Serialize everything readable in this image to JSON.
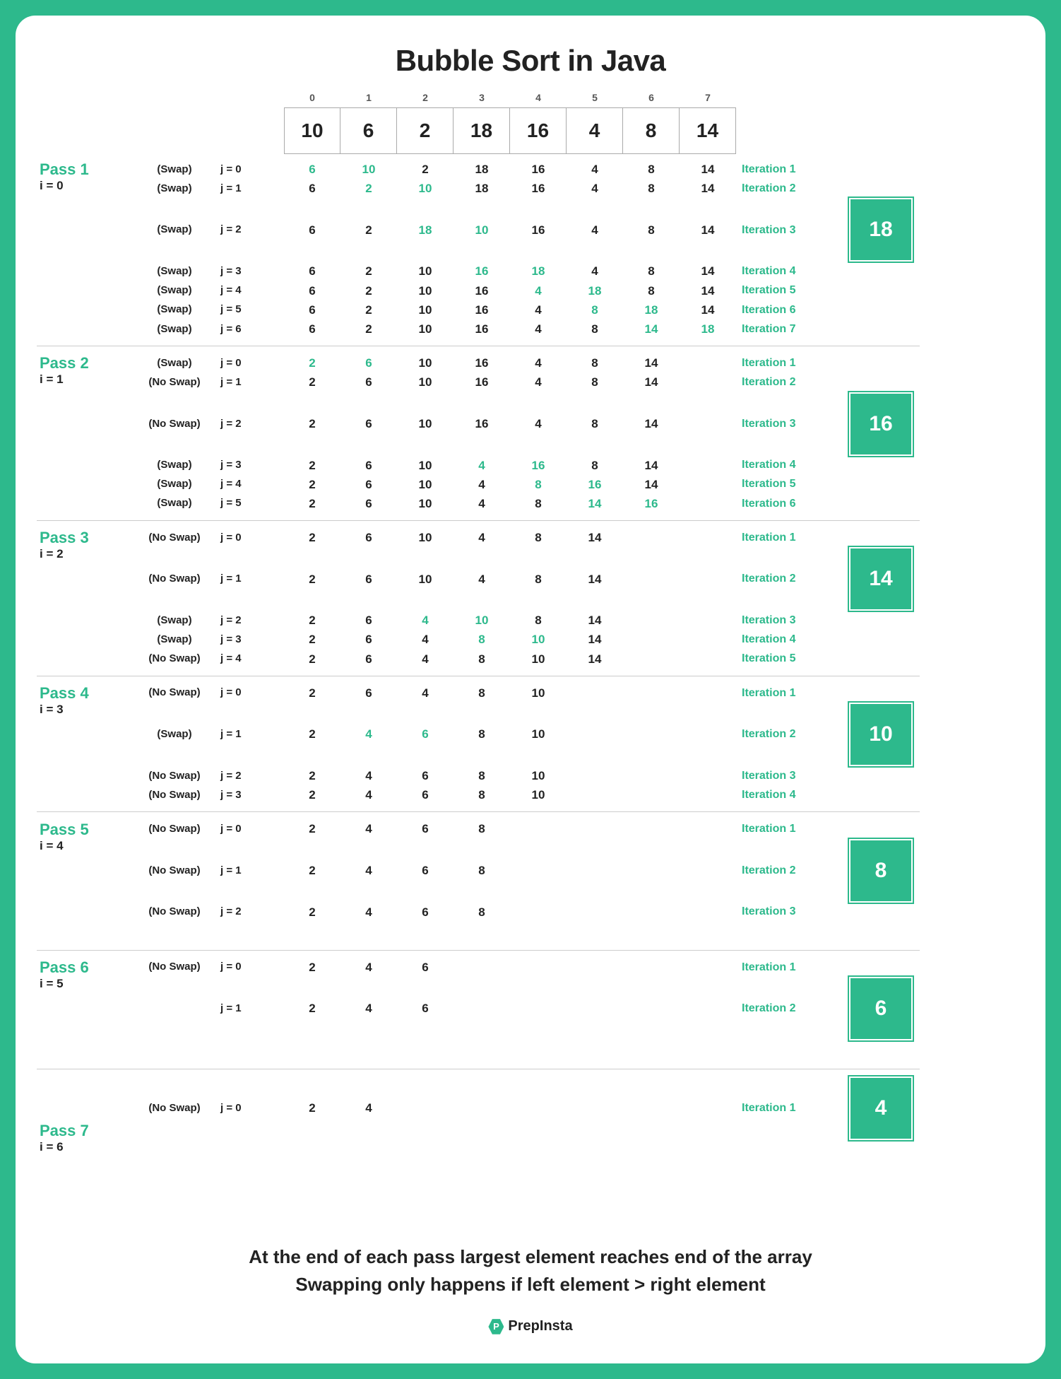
{
  "title": "Bubble Sort in Java",
  "indices": [
    "0",
    "1",
    "2",
    "3",
    "4",
    "5",
    "6",
    "7"
  ],
  "initial_array": [
    "10",
    "6",
    "2",
    "18",
    "16",
    "4",
    "8",
    "14"
  ],
  "passes": [
    {
      "name": "Pass 1",
      "i": "i = 0",
      "result": "18",
      "rows": [
        {
          "swap": "(Swap)",
          "j": "j = 0",
          "vals": [
            "6",
            "10",
            "2",
            "18",
            "16",
            "4",
            "8",
            "14"
          ],
          "hl": [
            0,
            1
          ],
          "iter": "Iteration 1"
        },
        {
          "swap": "(Swap)",
          "j": "j = 1",
          "vals": [
            "6",
            "2",
            "10",
            "18",
            "16",
            "4",
            "8",
            "14"
          ],
          "hl": [
            1,
            2
          ],
          "iter": "Iteration 2"
        },
        {
          "swap": "(Swap)",
          "j": "j = 2",
          "vals": [
            "6",
            "2",
            "18",
            "10",
            "16",
            "4",
            "8",
            "14"
          ],
          "hl": [
            2,
            3
          ],
          "iter": "Iteration 3"
        },
        {
          "swap": "(Swap)",
          "j": "j = 3",
          "vals": [
            "6",
            "2",
            "10",
            "16",
            "18",
            "4",
            "8",
            "14"
          ],
          "hl": [
            3,
            4
          ],
          "iter": "Iteration 4"
        },
        {
          "swap": "(Swap)",
          "j": "j = 4",
          "vals": [
            "6",
            "2",
            "10",
            "16",
            "4",
            "18",
            "8",
            "14"
          ],
          "hl": [
            4,
            5
          ],
          "iter": "Iteration 5"
        },
        {
          "swap": "(Swap)",
          "j": "j = 5",
          "vals": [
            "6",
            "2",
            "10",
            "16",
            "4",
            "8",
            "18",
            "14"
          ],
          "hl": [
            5,
            6
          ],
          "iter": "Iteration 6"
        },
        {
          "swap": "(Swap)",
          "j": "j = 6",
          "vals": [
            "6",
            "2",
            "10",
            "16",
            "4",
            "8",
            "14",
            "18"
          ],
          "hl": [
            6,
            7
          ],
          "iter": "Iteration 7"
        }
      ]
    },
    {
      "name": "Pass 2",
      "i": "i = 1",
      "result": "16",
      "rows": [
        {
          "swap": "(Swap)",
          "j": "j = 0",
          "vals": [
            "2",
            "6",
            "10",
            "16",
            "4",
            "8",
            "14",
            ""
          ],
          "hl": [
            0,
            1
          ],
          "iter": "Iteration 1"
        },
        {
          "swap": "(No Swap)",
          "j": "j = 1",
          "vals": [
            "2",
            "6",
            "10",
            "16",
            "4",
            "8",
            "14",
            ""
          ],
          "hl": [],
          "iter": "Iteration 2"
        },
        {
          "swap": "(No Swap)",
          "j": "j = 2",
          "vals": [
            "2",
            "6",
            "10",
            "16",
            "4",
            "8",
            "14",
            ""
          ],
          "hl": [],
          "iter": "Iteration 3"
        },
        {
          "swap": "(Swap)",
          "j": "j = 3",
          "vals": [
            "2",
            "6",
            "10",
            "4",
            "16",
            "8",
            "14",
            ""
          ],
          "hl": [
            3,
            4
          ],
          "iter": "Iteration 4"
        },
        {
          "swap": "(Swap)",
          "j": "j = 4",
          "vals": [
            "2",
            "6",
            "10",
            "4",
            "8",
            "16",
            "14",
            ""
          ],
          "hl": [
            4,
            5
          ],
          "iter": "Iteration 5"
        },
        {
          "swap": "(Swap)",
          "j": "j = 5",
          "vals": [
            "2",
            "6",
            "10",
            "4",
            "8",
            "14",
            "16",
            ""
          ],
          "hl": [
            5,
            6
          ],
          "iter": "Iteration 6"
        }
      ]
    },
    {
      "name": "Pass 3",
      "i": "i = 2",
      "result": "14",
      "rows": [
        {
          "swap": "(No Swap)",
          "j": "j = 0",
          "vals": [
            "2",
            "6",
            "10",
            "4",
            "8",
            "14",
            "",
            ""
          ],
          "hl": [],
          "iter": "Iteration 1"
        },
        {
          "swap": "(No Swap)",
          "j": "j = 1",
          "vals": [
            "2",
            "6",
            "10",
            "4",
            "8",
            "14",
            "",
            ""
          ],
          "hl": [],
          "iter": "Iteration 2"
        },
        {
          "swap": "(Swap)",
          "j": "j = 2",
          "vals": [
            "2",
            "6",
            "4",
            "10",
            "8",
            "14",
            "",
            ""
          ],
          "hl": [
            2,
            3
          ],
          "iter": "Iteration 3"
        },
        {
          "swap": "(Swap)",
          "j": "j = 3",
          "vals": [
            "2",
            "6",
            "4",
            "8",
            "10",
            "14",
            "",
            ""
          ],
          "hl": [
            3,
            4
          ],
          "iter": "Iteration 4"
        },
        {
          "swap": "(No Swap)",
          "j": "j = 4",
          "vals": [
            "2",
            "6",
            "4",
            "8",
            "10",
            "14",
            "",
            ""
          ],
          "hl": [],
          "iter": "Iteration 5"
        }
      ]
    },
    {
      "name": "Pass 4",
      "i": "i = 3",
      "result": "10",
      "rows": [
        {
          "swap": "(No Swap)",
          "j": "j = 0",
          "vals": [
            "2",
            "6",
            "4",
            "8",
            "10",
            "",
            "",
            ""
          ],
          "hl": [],
          "iter": "Iteration 1"
        },
        {
          "swap": "(Swap)",
          "j": "j = 1",
          "vals": [
            "2",
            "4",
            "6",
            "8",
            "10",
            "",
            "",
            ""
          ],
          "hl": [
            1,
            2
          ],
          "iter": "Iteration 2"
        },
        {
          "swap": "(No Swap)",
          "j": "j = 2",
          "vals": [
            "2",
            "4",
            "6",
            "8",
            "10",
            "",
            "",
            ""
          ],
          "hl": [],
          "iter": "Iteration 3"
        },
        {
          "swap": "(No Swap)",
          "j": "j = 3",
          "vals": [
            "2",
            "4",
            "6",
            "8",
            "10",
            "",
            "",
            ""
          ],
          "hl": [],
          "iter": "Iteration 4"
        }
      ]
    },
    {
      "name": "Pass 5",
      "i": "i = 4",
      "result": "8",
      "rows": [
        {
          "swap": "(No Swap)",
          "j": "j = 0",
          "vals": [
            "2",
            "4",
            "6",
            "8",
            "",
            "",
            "",
            ""
          ],
          "hl": [],
          "iter": "Iteration 1"
        },
        {
          "swap": "(No Swap)",
          "j": "j = 1",
          "vals": [
            "2",
            "4",
            "6",
            "8",
            "",
            "",
            "",
            ""
          ],
          "hl": [],
          "iter": "Iteration 2"
        },
        {
          "swap": "(No Swap)",
          "j": "j = 2",
          "vals": [
            "2",
            "4",
            "6",
            "8",
            "",
            "",
            "",
            ""
          ],
          "hl": [],
          "iter": "Iteration 3"
        }
      ]
    },
    {
      "name": "Pass 6",
      "i": "i = 5",
      "result": "6",
      "rows": [
        {
          "swap": "(No Swap)",
          "j": "j = 0",
          "vals": [
            "2",
            "4",
            "6",
            "",
            "",
            "",
            "",
            ""
          ],
          "hl": [],
          "iter": "Iteration 1"
        },
        {
          "swap": "",
          "j": "j = 1",
          "vals": [
            "2",
            "4",
            "6",
            "",
            "",
            "",
            "",
            ""
          ],
          "hl": [],
          "iter": "Iteration 2"
        }
      ]
    },
    {
      "name": "Pass 7",
      "i": "i = 6",
      "result": "4",
      "rows": [
        {
          "swap": "(No Swap)",
          "j": "j = 0",
          "vals": [
            "2",
            "4",
            "",
            "",
            "",
            "",
            "",
            ""
          ],
          "hl": [],
          "iter": "Iteration 1"
        }
      ]
    }
  ],
  "footer_line1": "At the end of each pass largest element reaches end of the array",
  "footer_line2": "Swapping only happens if left element > right element",
  "brand": "PrepInsta",
  "chart_data": {
    "type": "table",
    "description": "Bubble sort trace on array [10,6,2,18,16,4,8,14] over 7 passes",
    "initial": [
      10,
      6,
      2,
      18,
      16,
      4,
      8,
      14
    ],
    "sorted_tail_after_each_pass": [
      18,
      16,
      14,
      10,
      8,
      6,
      4
    ]
  }
}
